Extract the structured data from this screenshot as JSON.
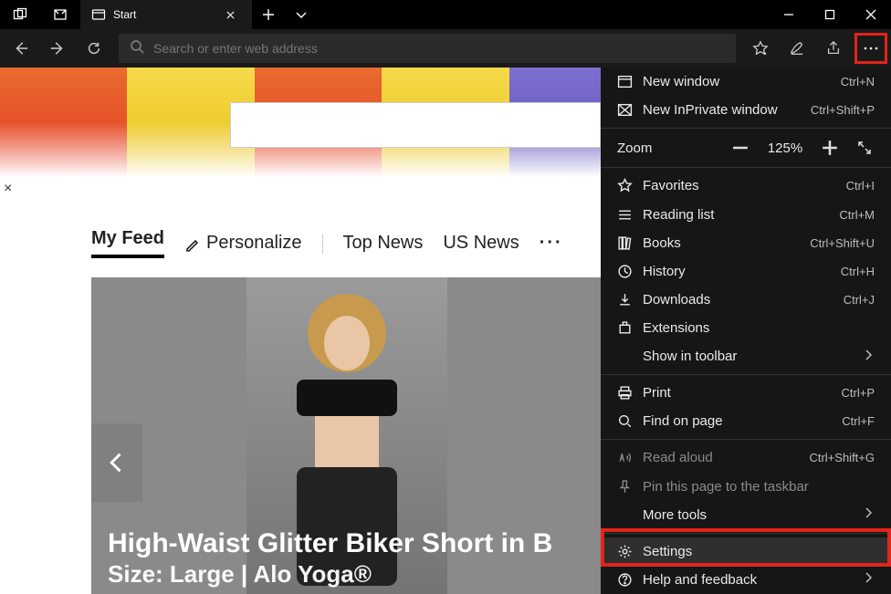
{
  "titlebar": {
    "tab_title": "Start"
  },
  "toolbar": {
    "address_placeholder": "Search or enter web address"
  },
  "page": {
    "close_x": "×",
    "feedbar": {
      "my_feed": "My Feed",
      "personalize": "Personalize",
      "top_news": "Top News",
      "us_news": "US News",
      "more": "···"
    },
    "card": {
      "line1": "High-Waist Glitter Biker Short in B",
      "line2": "Size: Large | Alo Yoga®"
    }
  },
  "menu": {
    "new_window": {
      "label": "New window",
      "shortcut": "Ctrl+N"
    },
    "new_inprivate": {
      "label": "New InPrivate window",
      "shortcut": "Ctrl+Shift+P"
    },
    "zoom": {
      "label": "Zoom",
      "value": "125%"
    },
    "favorites": {
      "label": "Favorites",
      "shortcut": "Ctrl+I"
    },
    "reading_list": {
      "label": "Reading list",
      "shortcut": "Ctrl+M"
    },
    "books": {
      "label": "Books",
      "shortcut": "Ctrl+Shift+U"
    },
    "history": {
      "label": "History",
      "shortcut": "Ctrl+H"
    },
    "downloads": {
      "label": "Downloads",
      "shortcut": "Ctrl+J"
    },
    "extensions": {
      "label": "Extensions"
    },
    "show_in_toolbar": {
      "label": "Show in toolbar"
    },
    "print": {
      "label": "Print",
      "shortcut": "Ctrl+P"
    },
    "find": {
      "label": "Find on page",
      "shortcut": "Ctrl+F"
    },
    "read_aloud": {
      "label": "Read aloud",
      "shortcut": "Ctrl+Shift+G"
    },
    "pin": {
      "label": "Pin this page to the taskbar"
    },
    "more_tools": {
      "label": "More tools"
    },
    "settings": {
      "label": "Settings"
    },
    "help": {
      "label": "Help and feedback"
    }
  }
}
